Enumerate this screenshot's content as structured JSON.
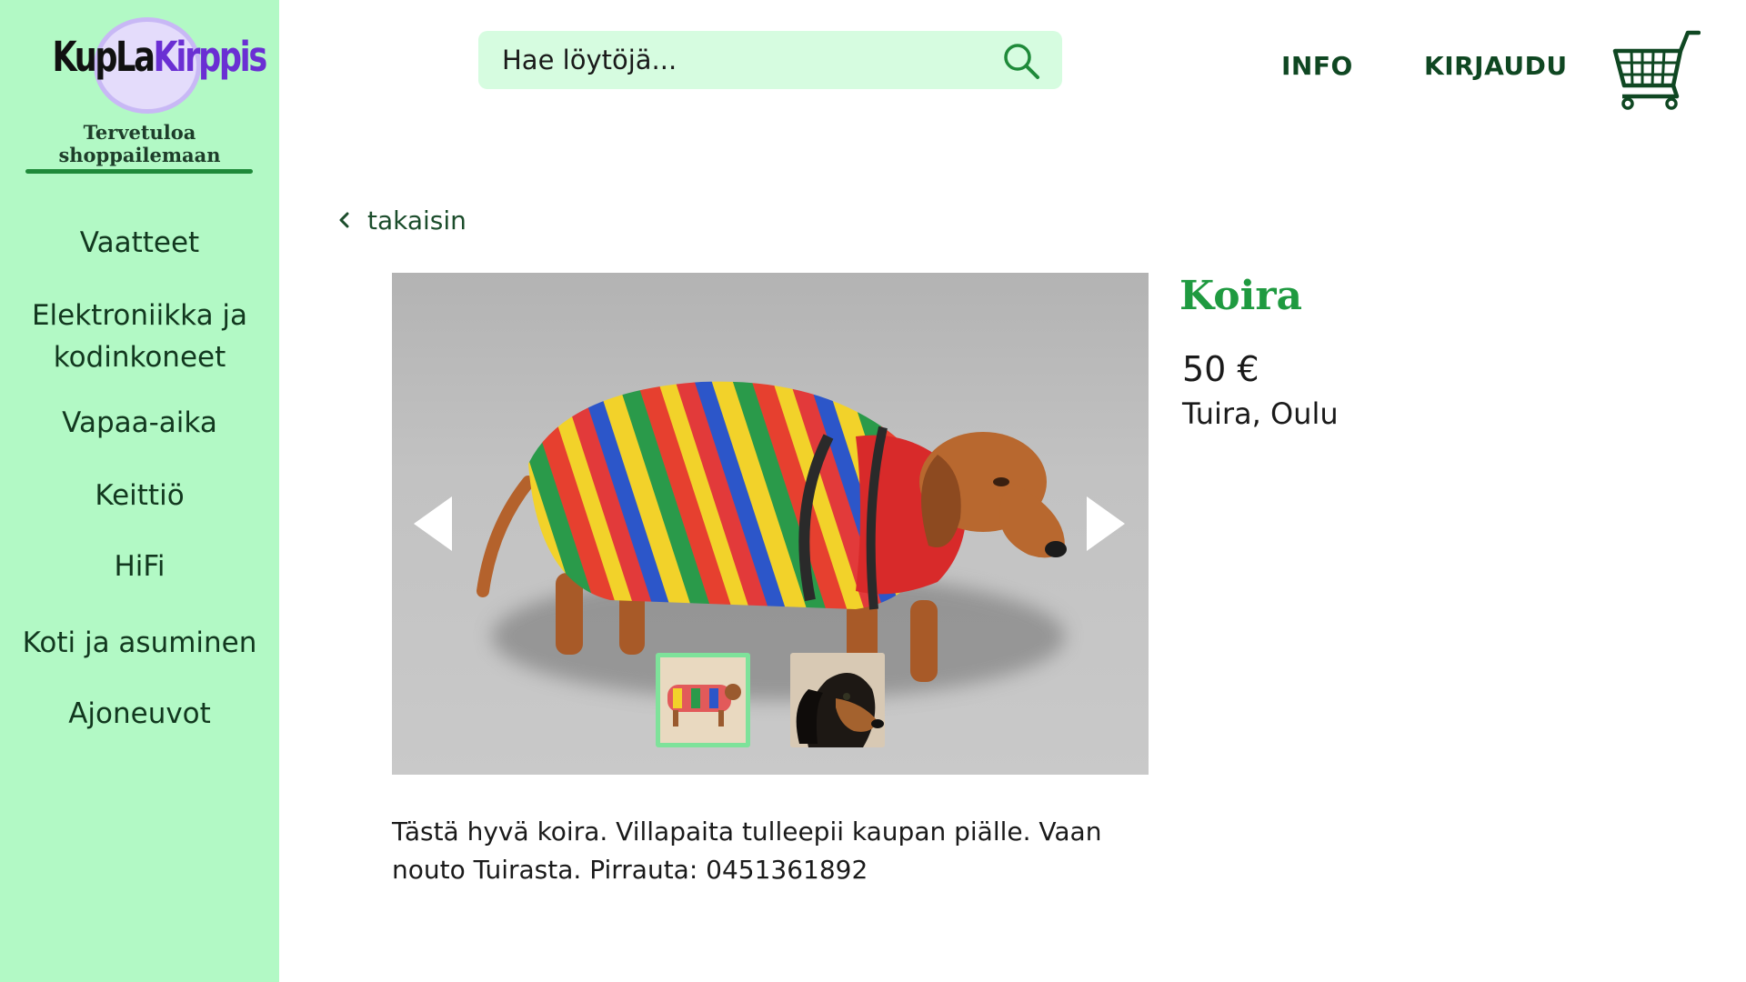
{
  "brand": {
    "logo_text_part1": "KupLa",
    "logo_text_part2": "Kirppis",
    "tagline": "Tervetuloa shoppailemaan"
  },
  "sidebar": {
    "items": [
      {
        "label": "Vaatteet"
      },
      {
        "label": "Elektroniikka ja kodinkoneet"
      },
      {
        "label": "Vapaa-aika"
      },
      {
        "label": "Keittiö"
      },
      {
        "label": "HiFi"
      },
      {
        "label": "Koti ja asuminen"
      },
      {
        "label": "Ajoneuvot"
      }
    ]
  },
  "header": {
    "search_placeholder": "Hae löytöjä...",
    "info_label": "INFO",
    "login_label": "KIRJAUDU"
  },
  "product": {
    "back_label": "takaisin",
    "title": "Koira",
    "price": "50 €",
    "location": "Tuira, Oulu",
    "description": "Tästä hyvä koira. Villapaita tulleepii kaupan piälle. Vaan nouto Tuirasta. Pirrauta: 0451361892"
  },
  "icons": {
    "search": "search-icon",
    "cart": "shopping-cart-icon",
    "back": "chevron-left-icon",
    "prev": "arrow-left-icon",
    "next": "arrow-right-icon"
  },
  "colors": {
    "sidebar_bg": "#b2f9c5",
    "search_bg": "#d6fce0",
    "accent_green": "#1f9a40",
    "dark_green": "#0f4722",
    "logo_purple": "#6a2fd3"
  }
}
